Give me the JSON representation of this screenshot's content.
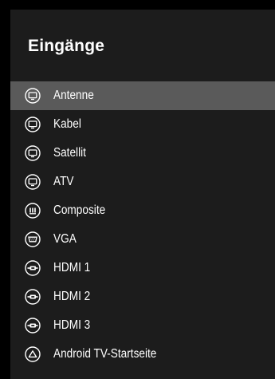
{
  "panel": {
    "title": "Eingänge",
    "selected_index": 0
  },
  "colors": {
    "background": "#000000",
    "panel": "#1c1c1c",
    "selection": "#5a5a5a",
    "text": "#ffffff"
  },
  "inputs": [
    {
      "label": "Antenne",
      "icon": "tv-icon"
    },
    {
      "label": "Kabel",
      "icon": "tv-icon"
    },
    {
      "label": "Satellit",
      "icon": "tv-icon"
    },
    {
      "label": "ATV",
      "icon": "tv-icon"
    },
    {
      "label": "Composite",
      "icon": "composite-icon"
    },
    {
      "label": "VGA",
      "icon": "vga-icon"
    },
    {
      "label": "HDMI 1",
      "icon": "hdmi-icon"
    },
    {
      "label": "HDMI 2",
      "icon": "hdmi-icon"
    },
    {
      "label": "HDMI 3",
      "icon": "hdmi-icon"
    },
    {
      "label": "Android TV-Startseite",
      "icon": "android-home-icon"
    }
  ]
}
